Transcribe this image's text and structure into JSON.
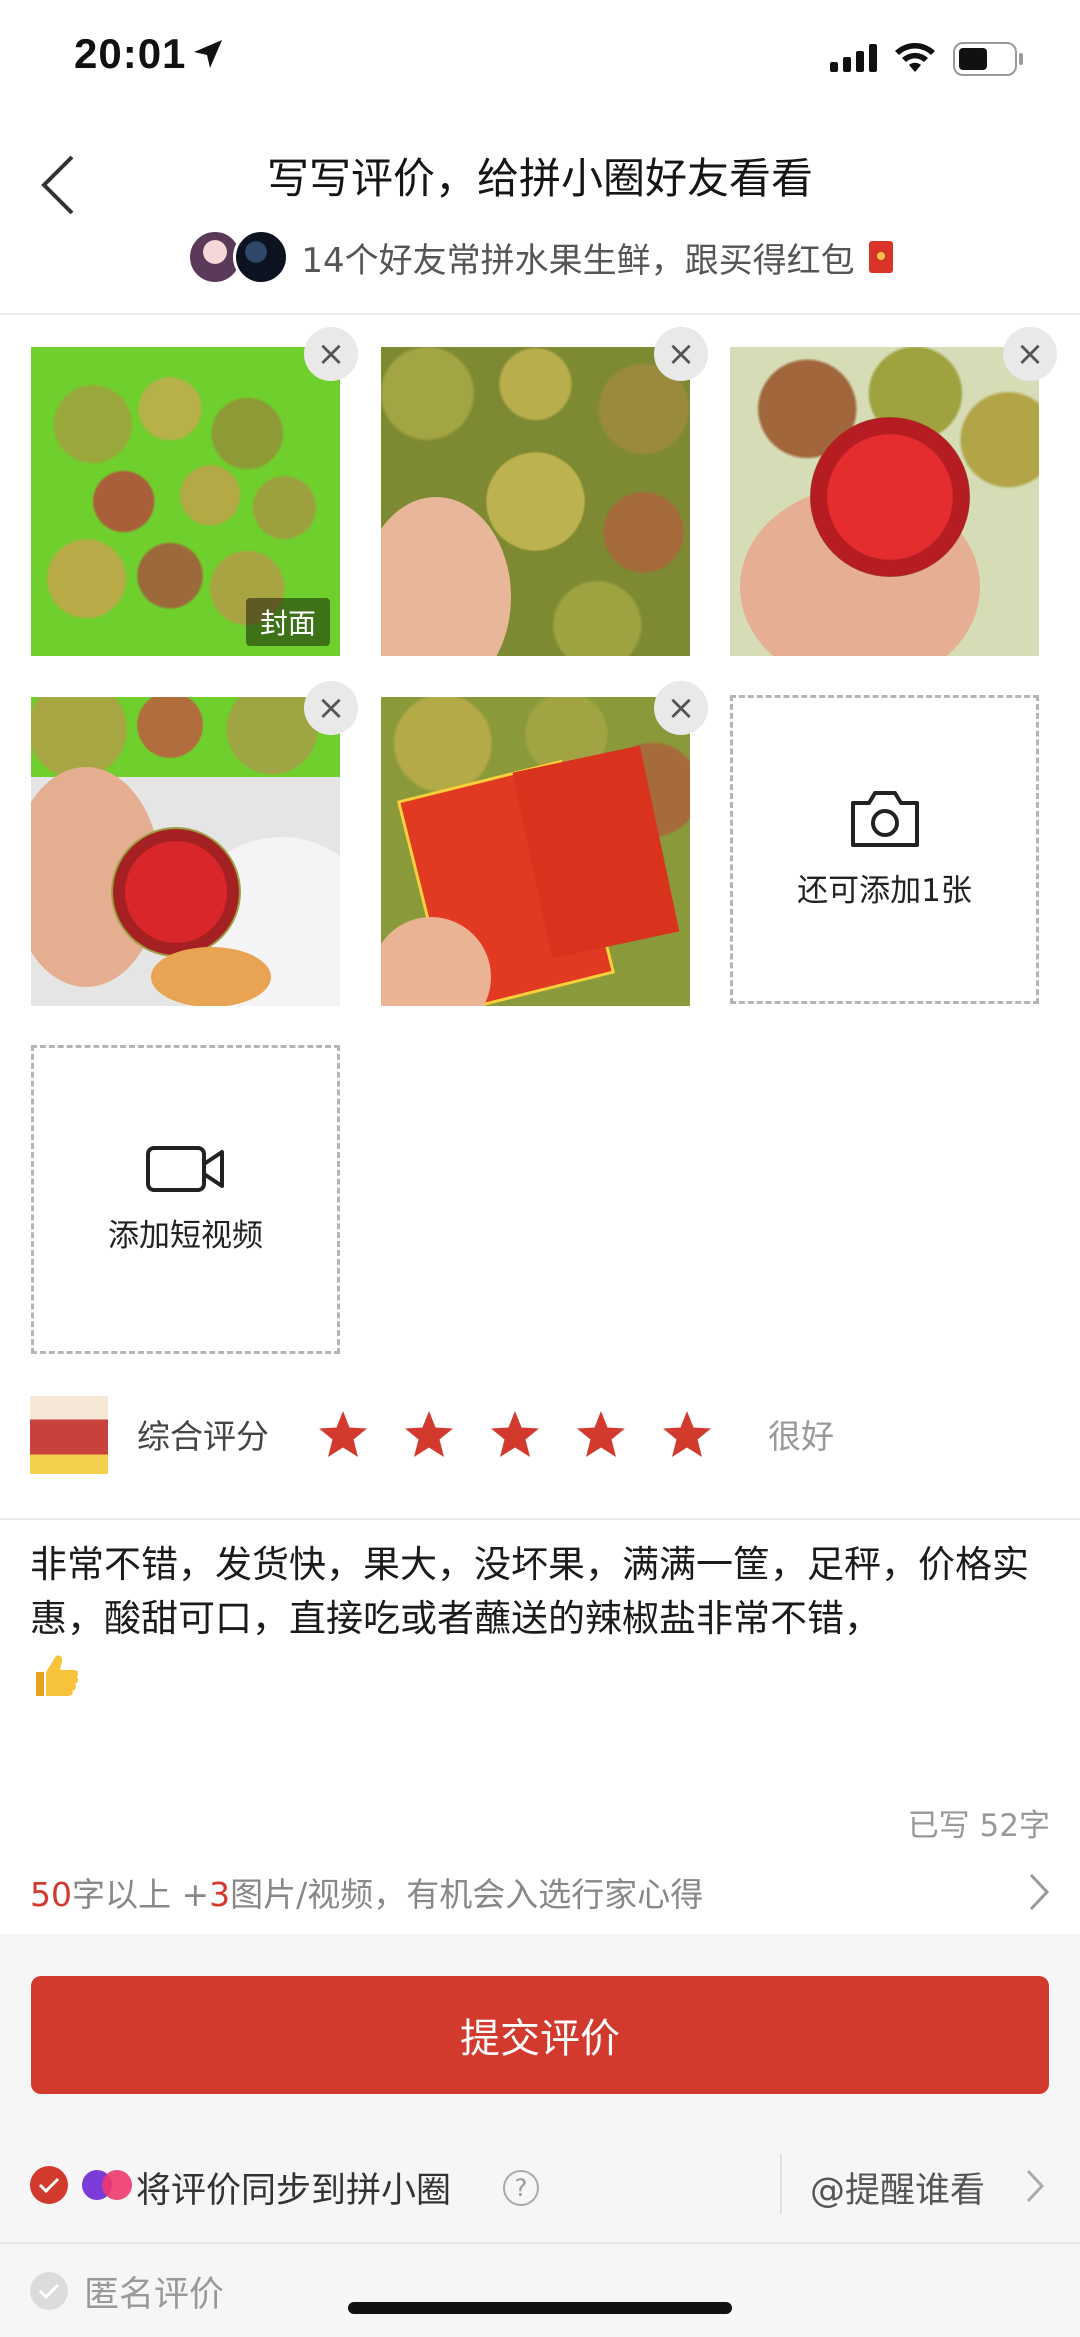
{
  "status_bar": {
    "time": "20:01",
    "icons": [
      "location-arrow-icon",
      "signal-icon",
      "wifi-icon",
      "battery-icon"
    ]
  },
  "header": {
    "back_icon": "chevron-left-icon",
    "title": "写写评价，给拼小圈好友看看",
    "subtitle": "14个好友常拼水果生鲜，跟买得红包"
  },
  "photos": {
    "cover_label": "封面",
    "close_symbol": "×",
    "add_photo_label": "还可添加1张",
    "add_video_label": "添加短视频"
  },
  "rating": {
    "label": "综合评分",
    "stars": 5,
    "max_stars": 5,
    "result": "很好",
    "star_color": "#d13a2d"
  },
  "review": {
    "text": "非常不错，发货快，果大，没坏果，满满一筐，足秤，价格实惠，酸甜可口，直接吃或者蘸送的辣椒盐非常不错，",
    "emoji": "thumbs-up-icon",
    "char_count": "已写 52字"
  },
  "tip": {
    "num1": "50",
    "text1": "字以上 +",
    "num2": "3",
    "text2": "图片/视频，有机会入选行家心得"
  },
  "bottom": {
    "submit_label": "提交评价",
    "sync_label": "将评价同步到拼小圈",
    "help_symbol": "?",
    "remind_label": "@提醒谁看",
    "anonymous_label": "匿名评价"
  },
  "colors": {
    "accent": "#d13a2d",
    "bottom_bg": "#f6f6f6"
  }
}
